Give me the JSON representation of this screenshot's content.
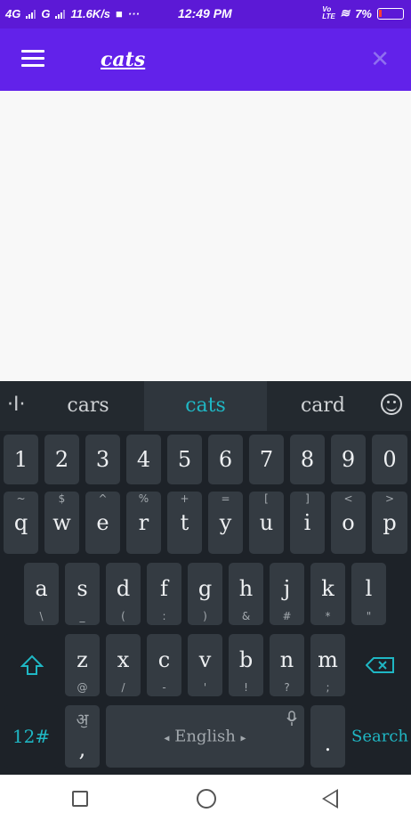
{
  "status_bar": {
    "net1": "4G",
    "net2": "G",
    "speed": "11.6K/s",
    "more": "···",
    "time": "12:49 PM",
    "volte": "Vo LTE",
    "battery": "7%"
  },
  "app_bar": {
    "search_query": "cats",
    "clear_symbol": "✕"
  },
  "keyboard": {
    "suggestions": [
      "cars",
      "cats",
      "card"
    ],
    "cursor_symbol": "·I·",
    "number_row": [
      "1",
      "2",
      "3",
      "4",
      "5",
      "6",
      "7",
      "8",
      "9",
      "0"
    ],
    "row1": [
      {
        "k": "q",
        "s": "~"
      },
      {
        "k": "w",
        "s": "$"
      },
      {
        "k": "e",
        "s": "^"
      },
      {
        "k": "r",
        "s": "%"
      },
      {
        "k": "t",
        "s": "+"
      },
      {
        "k": "y",
        "s": "="
      },
      {
        "k": "u",
        "s": "["
      },
      {
        "k": "i",
        "s": "]"
      },
      {
        "k": "o",
        "s": "<"
      },
      {
        "k": "p",
        "s": ">"
      }
    ],
    "row2": [
      {
        "k": "a",
        "s": "\\"
      },
      {
        "k": "s",
        "s": "_"
      },
      {
        "k": "d",
        "s": "("
      },
      {
        "k": "f",
        "s": ":"
      },
      {
        "k": "g",
        "s": ")"
      },
      {
        "k": "h",
        "s": "&"
      },
      {
        "k": "j",
        "s": "#"
      },
      {
        "k": "k",
        "s": "*"
      },
      {
        "k": "l",
        "s": "\""
      }
    ],
    "row3": [
      {
        "k": "z",
        "s": "@"
      },
      {
        "k": "x",
        "s": "/"
      },
      {
        "k": "c",
        "s": "-"
      },
      {
        "k": "v",
        "s": "'"
      },
      {
        "k": "b",
        "s": "!"
      },
      {
        "k": "n",
        "s": "?"
      },
      {
        "k": "m",
        "s": ";"
      }
    ],
    "symbols_label": "12#",
    "comma_key": ",",
    "space_label": "English",
    "period_key": ".",
    "search_label": "Search"
  },
  "colors": {
    "status_bar": "#5c19d6",
    "app_bar": "#6222ea",
    "keyboard_bg": "#1d2228",
    "key_bg": "#343b42",
    "accent": "#1fb7c4"
  }
}
